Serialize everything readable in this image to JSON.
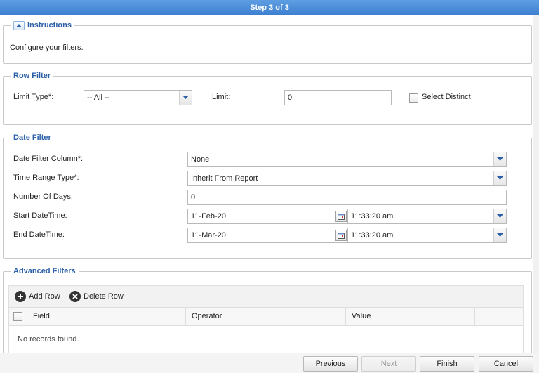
{
  "window": {
    "step_title": "Step 3 of 3"
  },
  "instructions": {
    "legend": "Instructions",
    "text": "Configure your filters."
  },
  "row_filter": {
    "legend": "Row Filter",
    "limit_type_label": "Limit Type*:",
    "limit_type_value": "-- All --",
    "limit_label": "Limit:",
    "limit_value": "0",
    "select_distinct_label": "Select Distinct",
    "select_distinct_checked": false
  },
  "date_filter": {
    "legend": "Date Filter",
    "date_filter_column_label": "Date Filter Column*:",
    "date_filter_column_value": "None",
    "time_range_type_label": "Time Range Type*:",
    "time_range_type_value": "Inherit From Report",
    "number_of_days_label": "Number Of Days:",
    "number_of_days_value": "0",
    "start_datetime_label": "Start DateTime:",
    "start_date_value": "11-Feb-20",
    "start_time_value": "11:33:20 am",
    "end_datetime_label": "End DateTime:",
    "end_date_value": "11-Mar-20",
    "end_time_value": "11:33:20 am"
  },
  "advanced_filters": {
    "legend": "Advanced Filters",
    "add_row_label": "Add Row",
    "delete_row_label": "Delete Row",
    "columns": [
      "Field",
      "Operator",
      "Value"
    ],
    "empty_message": "No records found."
  },
  "footer": {
    "previous_label": "Previous",
    "next_label": "Next",
    "finish_label": "Finish",
    "cancel_label": "Cancel"
  }
}
